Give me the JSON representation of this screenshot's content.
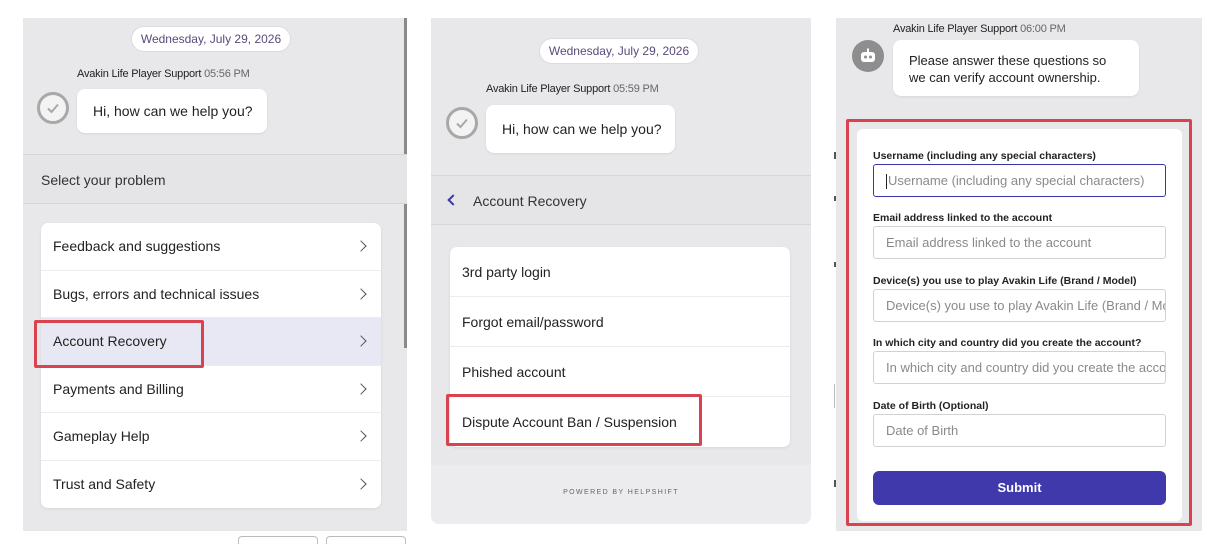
{
  "panel1": {
    "date": "Wednesday, July 29, 2026",
    "sender_name": "Avakin Life Player Support",
    "sender_time": "05:56 PM",
    "message": "Hi, how can we help you?",
    "section_title": "Select your problem",
    "menu_items": [
      {
        "label": "Feedback and suggestions"
      },
      {
        "label": "Bugs, errors and technical issues"
      },
      {
        "label": "Account Recovery"
      },
      {
        "label": "Payments and Billing"
      },
      {
        "label": "Gameplay Help"
      },
      {
        "label": "Trust and Safety"
      }
    ],
    "selected_item": "Account Recovery"
  },
  "panel2": {
    "date": "Wednesday, July 29, 2026",
    "sender_name": "Avakin Life Player Support",
    "sender_time": "05:59 PM",
    "message": "Hi, how can we help you?",
    "section_title": "Account Recovery",
    "menu_items": [
      {
        "label": "3rd party login"
      },
      {
        "label": "Forgot email/password"
      },
      {
        "label": "Phished account"
      },
      {
        "label": "Dispute Account Ban / Suspension"
      }
    ],
    "selected_item": "Dispute Account Ban / Suspension",
    "footer": "POWERED BY HELPSHIFT"
  },
  "panel3": {
    "sender_name": "Avakin Life Player Support",
    "sender_time": "06:00 PM",
    "message_line1": "Please answer these questions so",
    "message_line2": "we can verify account ownership.",
    "fields": [
      {
        "label": "Username (including any special characters)",
        "placeholder": "Username (including any special characters)"
      },
      {
        "label": "Email address linked to the account",
        "placeholder": "Email address linked to the account"
      },
      {
        "label": "Device(s) you use to play Avakin Life (Brand / Model)",
        "placeholder": "Device(s) you use to play Avakin Life (Brand / Model)"
      },
      {
        "label": "In which city and country did you create the account?",
        "placeholder": "In which city and country did you create the account?"
      },
      {
        "label": "Date of Birth (Optional)",
        "placeholder": "Date of Birth"
      }
    ],
    "submit_label": "Submit"
  },
  "colors": {
    "highlight_border": "#d9434f",
    "accent": "#4039ab",
    "panel_bg": "#e8e8ea"
  },
  "icons": {
    "support_avatar": "check-circle-icon",
    "bot_avatar": "robot-icon",
    "menu_chevron": "chevron-right-icon",
    "back": "chevron-left-icon"
  }
}
